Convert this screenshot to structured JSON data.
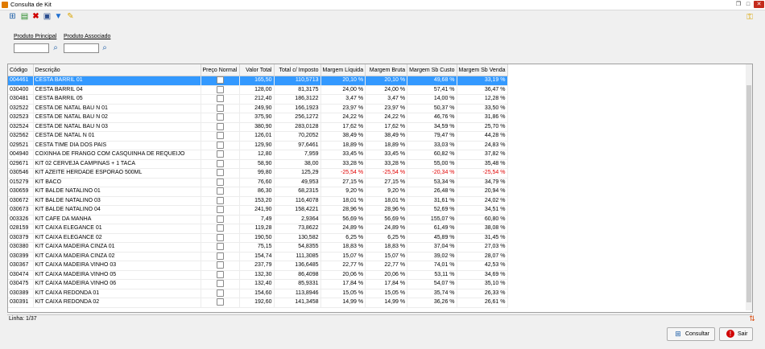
{
  "window": {
    "title": "Consulta de Kit",
    "icon": "app-icon",
    "controls": [
      "restore-icon",
      "maximize-icon",
      "close-icon"
    ]
  },
  "toolbar": {
    "icons": [
      "search-grid-icon",
      "new-document-icon",
      "delete-icon",
      "print-icon",
      "filter-icon",
      "edit-icon"
    ],
    "right_icon": "key-icon"
  },
  "filters": {
    "produto_principal_label": "Produto Principal",
    "produto_principal_value": "",
    "produto_associado_label": "Produto Associado",
    "produto_associado_value": ""
  },
  "table": {
    "columns": [
      "Código",
      "Descrição",
      "Preço Normal",
      "Valor Total",
      "Total c/ Imposto",
      "Margem Líquida",
      "Margem Bruta",
      "Margem Sb Custo",
      "Margem Sb Venda"
    ],
    "rows": [
      {
        "codigo": "004461",
        "descricao": "CESTA BARRIL 01",
        "valor_total": "165,50",
        "total_imposto": "110,5713",
        "margem_liquida": "20,10 %",
        "margem_bruta": "20,10 %",
        "margem_sb_custo": "49,68 %",
        "margem_sb_venda": "33,19 %",
        "selected": true
      },
      {
        "codigo": "030400",
        "descricao": "CESTA BARRIL 04",
        "valor_total": "128,00",
        "total_imposto": "81,3175",
        "margem_liquida": "24,00 %",
        "margem_bruta": "24,00 %",
        "margem_sb_custo": "57,41 %",
        "margem_sb_venda": "36,47 %"
      },
      {
        "codigo": "030481",
        "descricao": "CESTA BARRIL 05",
        "valor_total": "212,40",
        "total_imposto": "186,3122",
        "margem_liquida": "3,47 %",
        "margem_bruta": "3,47 %",
        "margem_sb_custo": "14,00 %",
        "margem_sb_venda": "12,28 %"
      },
      {
        "codigo": "032522",
        "descricao": "CESTA DE NATAL BAU N 01",
        "valor_total": "249,90",
        "total_imposto": "166,1923",
        "margem_liquida": "23,97 %",
        "margem_bruta": "23,97 %",
        "margem_sb_custo": "50,37 %",
        "margem_sb_venda": "33,50 %"
      },
      {
        "codigo": "032523",
        "descricao": "CESTA DE NATAL BAU N 02",
        "valor_total": "375,90",
        "total_imposto": "256,1272",
        "margem_liquida": "24,22 %",
        "margem_bruta": "24,22 %",
        "margem_sb_custo": "46,76 %",
        "margem_sb_venda": "31,86 %"
      },
      {
        "codigo": "032524",
        "descricao": "CESTA DE NATAL BAU N 03",
        "valor_total": "380,90",
        "total_imposto": "283,0128",
        "margem_liquida": "17,62 %",
        "margem_bruta": "17,62 %",
        "margem_sb_custo": "34,59 %",
        "margem_sb_venda": "25,70 %"
      },
      {
        "codigo": "032562",
        "descricao": "CESTA DE NATAL N 01",
        "valor_total": "126,01",
        "total_imposto": "70,2052",
        "margem_liquida": "38,49 %",
        "margem_bruta": "38,49 %",
        "margem_sb_custo": "79,47 %",
        "margem_sb_venda": "44,28 %"
      },
      {
        "codigo": "029521",
        "descricao": "CESTA TIME DIA DOS PAIS",
        "valor_total": "129,90",
        "total_imposto": "97,6461",
        "margem_liquida": "18,89 %",
        "margem_bruta": "18,89 %",
        "margem_sb_custo": "33,03 %",
        "margem_sb_venda": "24,83 %"
      },
      {
        "codigo": "004940",
        "descricao": "COXINHA DE FRANGO COM CASQUINHA DE REQUEIJO",
        "valor_total": "12,80",
        "total_imposto": "7,959",
        "margem_liquida": "33,45 %",
        "margem_bruta": "33,45 %",
        "margem_sb_custo": "60,82 %",
        "margem_sb_venda": "37,82 %"
      },
      {
        "codigo": "029671",
        "descricao": "KIT 02 CERVEJA CAMPINAS + 1 TACA",
        "valor_total": "58,90",
        "total_imposto": "38,00",
        "margem_liquida": "33,28 %",
        "margem_bruta": "33,28 %",
        "margem_sb_custo": "55,00 %",
        "margem_sb_venda": "35,48 %"
      },
      {
        "codigo": "030546",
        "descricao": "KIT AZEITE HERDADE ESPORAO 500ML",
        "valor_total": "99,80",
        "total_imposto": "125,29",
        "margem_liquida": "-25,54 %",
        "margem_bruta": "-25,54 %",
        "margem_sb_custo": "-20,34 %",
        "margem_sb_venda": "-25,54 %",
        "negative": true
      },
      {
        "codigo": "015279",
        "descricao": "KIT BACO",
        "valor_total": "76,60",
        "total_imposto": "49,953",
        "margem_liquida": "27,15 %",
        "margem_bruta": "27,15 %",
        "margem_sb_custo": "53,34 %",
        "margem_sb_venda": "34,79 %"
      },
      {
        "codigo": "030659",
        "descricao": "KIT BALDE NATALINO 01",
        "valor_total": "86,30",
        "total_imposto": "68,2315",
        "margem_liquida": "9,20 %",
        "margem_bruta": "9,20 %",
        "margem_sb_custo": "26,48 %",
        "margem_sb_venda": "20,94 %"
      },
      {
        "codigo": "030672",
        "descricao": "KIT BALDE NATALINO 03",
        "valor_total": "153,20",
        "total_imposto": "116,4078",
        "margem_liquida": "18,01 %",
        "margem_bruta": "18,01 %",
        "margem_sb_custo": "31,61 %",
        "margem_sb_venda": "24,02 %"
      },
      {
        "codigo": "030673",
        "descricao": "KIT BALDE NATALINO 04",
        "valor_total": "241,90",
        "total_imposto": "158,4221",
        "margem_liquida": "28,96 %",
        "margem_bruta": "28,96 %",
        "margem_sb_custo": "52,69 %",
        "margem_sb_venda": "34,51 %"
      },
      {
        "codigo": "003326",
        "descricao": "KIT CAFE DA MANHA",
        "valor_total": "7,49",
        "total_imposto": "2,9364",
        "margem_liquida": "56,69 %",
        "margem_bruta": "56,69 %",
        "margem_sb_custo": "155,07 %",
        "margem_sb_venda": "60,80 %"
      },
      {
        "codigo": "028159",
        "descricao": "KIT CAIXA ELEGANCE 01",
        "valor_total": "119,28",
        "total_imposto": "73,8622",
        "margem_liquida": "24,89 %",
        "margem_bruta": "24,89 %",
        "margem_sb_custo": "61,49 %",
        "margem_sb_venda": "38,08 %"
      },
      {
        "codigo": "030379",
        "descricao": "KIT CAIXA ELEGANCE 02",
        "valor_total": "190,50",
        "total_imposto": "130,582",
        "margem_liquida": "6,25 %",
        "margem_bruta": "6,25 %",
        "margem_sb_custo": "45,89 %",
        "margem_sb_venda": "31,45 %"
      },
      {
        "codigo": "030380",
        "descricao": "KIT CAIXA MADEIRA CINZA 01",
        "valor_total": "75,15",
        "total_imposto": "54,8355",
        "margem_liquida": "18,83 %",
        "margem_bruta": "18,83 %",
        "margem_sb_custo": "37,04 %",
        "margem_sb_venda": "27,03 %"
      },
      {
        "codigo": "030399",
        "descricao": "KIT CAIXA MADEIRA CINZA 02",
        "valor_total": "154,74",
        "total_imposto": "111,3085",
        "margem_liquida": "15,07 %",
        "margem_bruta": "15,07 %",
        "margem_sb_custo": "39,02 %",
        "margem_sb_venda": "28,07 %"
      },
      {
        "codigo": "030367",
        "descricao": "KIT CAIXA MADEIRA VINHO 03",
        "valor_total": "237,79",
        "total_imposto": "136,6485",
        "margem_liquida": "22,77 %",
        "margem_bruta": "22,77 %",
        "margem_sb_custo": "74,01 %",
        "margem_sb_venda": "42,53 %"
      },
      {
        "codigo": "030474",
        "descricao": "KIT CAIXA MADEIRA VINHO 05",
        "valor_total": "132,30",
        "total_imposto": "86,4098",
        "margem_liquida": "20,06 %",
        "margem_bruta": "20,06 %",
        "margem_sb_custo": "53,11 %",
        "margem_sb_venda": "34,69 %"
      },
      {
        "codigo": "030475",
        "descricao": "KIT CAIXA MADEIRA VINHO 06",
        "valor_total": "132,40",
        "total_imposto": "85,9331",
        "margem_liquida": "17,84 %",
        "margem_bruta": "17,84 %",
        "margem_sb_custo": "54,07 %",
        "margem_sb_venda": "35,10 %"
      },
      {
        "codigo": "030389",
        "descricao": "KIT CAIXA REDONDA 01",
        "valor_total": "154,60",
        "total_imposto": "113,8946",
        "margem_liquida": "15,05 %",
        "margem_bruta": "15,05 %",
        "margem_sb_custo": "35,74 %",
        "margem_sb_venda": "26,33 %"
      },
      {
        "codigo": "030391",
        "descricao": "KIT CAIXA REDONDA 02",
        "valor_total": "192,60",
        "total_imposto": "141,3458",
        "margem_liquida": "14,99 %",
        "margem_bruta": "14,99 %",
        "margem_sb_custo": "36,26 %",
        "margem_sb_venda": "26,61 %"
      }
    ]
  },
  "status": {
    "linha_label": "Linha: 1/37",
    "icon": "sort-icon"
  },
  "buttons": {
    "consultar_label": "Consultar",
    "consultar_icon": "search-grid-icon",
    "sair_label": "Sair",
    "sair_icon": "exit-icon"
  }
}
